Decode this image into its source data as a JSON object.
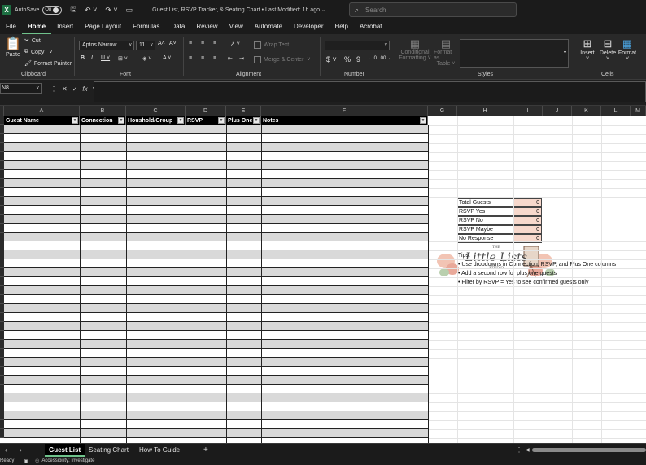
{
  "window": {
    "app_icon": "X",
    "autosave_label": "AutoSave",
    "autosave_state": "On",
    "title": "Guest List, RSVP Tracker, & Seating Chart • Last Modified: 1h ago",
    "title_chevron": "⌄",
    "search_placeholder": "Search"
  },
  "menu": [
    "File",
    "Home",
    "Insert",
    "Page Layout",
    "Formulas",
    "Data",
    "Review",
    "View",
    "Automate",
    "Developer",
    "Help",
    "Acrobat"
  ],
  "ribbon": {
    "paste": "Paste",
    "cut": "Cut",
    "copy": "Copy",
    "format_painter": "Format Painter",
    "clipboard": "Clipboard",
    "font_name": "Aptos Narrow",
    "font_size": "11",
    "font": "Font",
    "wrap_text": "Wrap Text",
    "merge_center": "Merge & Center",
    "alignment": "Alignment",
    "number": "Number",
    "conditional_formatting_1": "Conditional",
    "conditional_formatting_2": "Formatting ˅",
    "format_as_table_1": "Format as",
    "format_as_table_2": "Table ˅",
    "styles": "Styles",
    "insert": "Insert",
    "delete": "Delete",
    "format": "Format",
    "cells": "Cells"
  },
  "formula_bar": {
    "name_box": "N8",
    "fx": "fx"
  },
  "columns": [
    "A",
    "B",
    "C",
    "D",
    "E",
    "F",
    "G",
    "H",
    "I",
    "J",
    "K",
    "L",
    "M"
  ],
  "table_headers": [
    "Guest Name",
    "Connection",
    "Houshold/Group",
    "RSVP",
    "Plus One",
    "Notes"
  ],
  "logo": {
    "line1": "THE",
    "line2": "Little Lists",
    "line3": "STUDIO"
  },
  "summary": [
    {
      "label": "Total Guests",
      "value": "0"
    },
    {
      "label": "RSVP Yes",
      "value": "0"
    },
    {
      "label": "RSVP No",
      "value": "0"
    },
    {
      "label": "RSVP Maybe",
      "value": "0"
    },
    {
      "label": "No Response",
      "value": "0"
    }
  ],
  "tips": {
    "heading": "Tips:",
    "items": [
      "• Use dropdowns in Connection, RSVP, and Plus One columns",
      "• Add a second row for plus one guests",
      "• Filter by RSVP = Yes to see confirmed guests only"
    ]
  },
  "sheets": [
    "Guest List",
    "Seating Chart",
    "How To Guide"
  ],
  "status": {
    "ready": "Ready",
    "accessibility": "Accessibility: Investigate"
  }
}
